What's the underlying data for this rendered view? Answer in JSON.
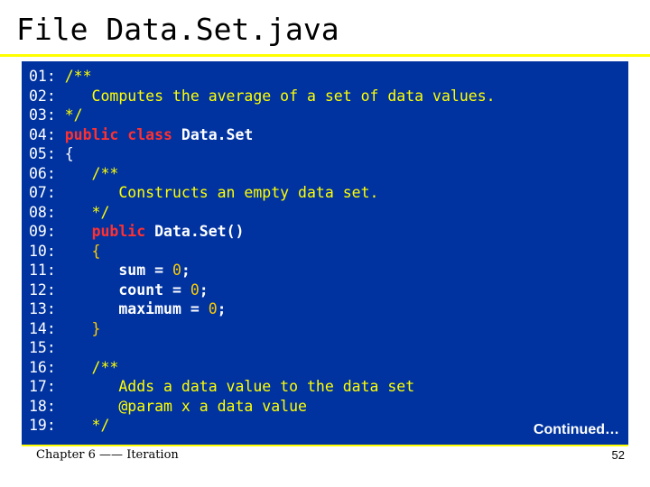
{
  "slide": {
    "title_prefix": "File",
    "title_file": "Data.Set.java",
    "accent_color": "#ffff00",
    "code_background": "#0033a0",
    "continued_label": "Continued…",
    "footer_left": "Chapter 6 —— Iteration",
    "footer_right": "52"
  },
  "code": {
    "lines": [
      {
        "num": "01:",
        "tokens": [
          {
            "t": "/**",
            "c": "cm"
          }
        ]
      },
      {
        "num": "02:",
        "tokens": [
          {
            "t": "   Computes the average of a set of data values.",
            "c": "cm"
          }
        ]
      },
      {
        "num": "03:",
        "tokens": [
          {
            "t": "*/",
            "c": "cm"
          }
        ]
      },
      {
        "num": "04:",
        "tokens": [
          {
            "t": "public class ",
            "c": "kw"
          },
          {
            "t": "Data.Set",
            "c": "cls"
          }
        ]
      },
      {
        "num": "05:",
        "tokens": [
          {
            "t": "{",
            "c": "pn"
          }
        ]
      },
      {
        "num": "06:",
        "tokens": [
          {
            "t": "   /**",
            "c": "cm"
          }
        ]
      },
      {
        "num": "07:",
        "tokens": [
          {
            "t": "      Constructs an empty data set.",
            "c": "cm"
          }
        ]
      },
      {
        "num": "08:",
        "tokens": [
          {
            "t": "   */",
            "c": "cm"
          }
        ]
      },
      {
        "num": "09:",
        "tokens": [
          {
            "t": "   ",
            "c": "pn"
          },
          {
            "t": "public ",
            "c": "kw"
          },
          {
            "t": "Data.Set()",
            "c": "cls"
          }
        ]
      },
      {
        "num": "10:",
        "tokens": [
          {
            "t": "   {",
            "c": "num"
          }
        ]
      },
      {
        "num": "11:",
        "tokens": [
          {
            "t": "      sum = ",
            "c": "id"
          },
          {
            "t": "0",
            "c": "num"
          },
          {
            "t": ";",
            "c": "id"
          }
        ]
      },
      {
        "num": "12:",
        "tokens": [
          {
            "t": "      count = ",
            "c": "id"
          },
          {
            "t": "0",
            "c": "num"
          },
          {
            "t": ";",
            "c": "id"
          }
        ]
      },
      {
        "num": "13:",
        "tokens": [
          {
            "t": "      maximum = ",
            "c": "id"
          },
          {
            "t": "0",
            "c": "num"
          },
          {
            "t": ";",
            "c": "id"
          }
        ]
      },
      {
        "num": "14:",
        "tokens": [
          {
            "t": "   }",
            "c": "num"
          }
        ]
      },
      {
        "num": "15:",
        "tokens": []
      },
      {
        "num": "16:",
        "tokens": [
          {
            "t": "   /**",
            "c": "cm"
          }
        ]
      },
      {
        "num": "17:",
        "tokens": [
          {
            "t": "      Adds a data value to the data set",
            "c": "cm"
          }
        ]
      },
      {
        "num": "18:",
        "tokens": [
          {
            "t": "      @param x a data value",
            "c": "cm"
          }
        ]
      },
      {
        "num": "19:",
        "tokens": [
          {
            "t": "   */",
            "c": "cm"
          }
        ]
      }
    ]
  }
}
